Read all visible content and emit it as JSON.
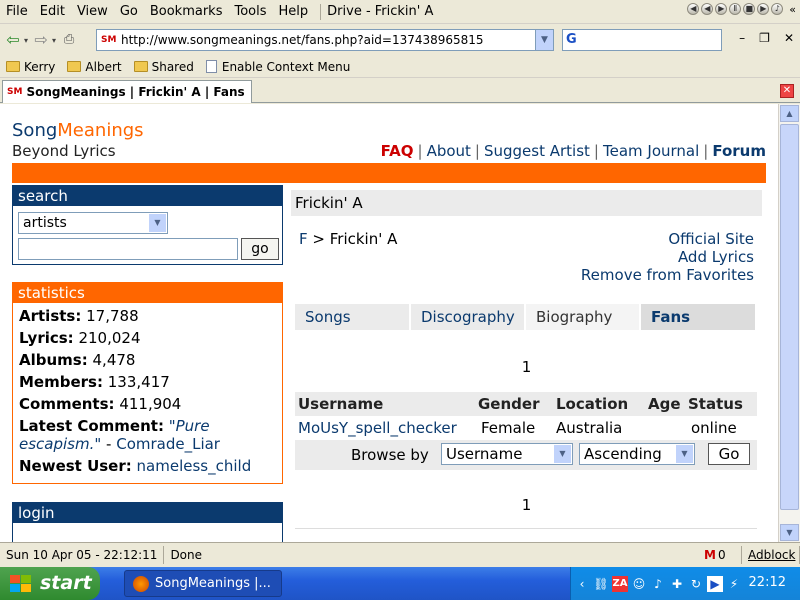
{
  "menu": {
    "items": [
      "File",
      "Edit",
      "View",
      "Go",
      "Bookmarks",
      "Tools",
      "Help"
    ],
    "window_title": "Drive - Frickin' A"
  },
  "nav": {
    "url": "http://www.songmeanings.net/fans.php?aid=137438965815",
    "search_engine_letter": "G"
  },
  "bookmarks": [
    {
      "label": "Kerry",
      "icon": "folder-icon"
    },
    {
      "label": "Albert",
      "icon": "folder-icon"
    },
    {
      "label": "Shared",
      "icon": "folder-icon"
    },
    {
      "label": "Enable Context Menu",
      "icon": "page-icon"
    }
  ],
  "tab": {
    "favicon": "SM",
    "title": "SongMeanings | Frickin' A | Fans"
  },
  "site": {
    "logo_song": "Song",
    "logo_meanings": "Meanings",
    "tagline": "Beyond Lyrics",
    "nav": [
      "FAQ",
      "About",
      "Suggest Artist",
      "Team Journal",
      "Forum"
    ],
    "separator": "|"
  },
  "search": {
    "header": "search",
    "selected": "artists",
    "go": "go"
  },
  "statistics": {
    "header": "statistics",
    "rows": [
      {
        "label": "Artists:",
        "value": "17,788"
      },
      {
        "label": "Lyrics:",
        "value": "210,024"
      },
      {
        "label": "Albums:",
        "value": "4,478"
      },
      {
        "label": "Members:",
        "value": "133,417"
      },
      {
        "label": "Comments:",
        "value": "411,904"
      }
    ],
    "latest_label": "Latest Comment:",
    "latest_quote": "\"Pure escapism.\"",
    "latest_dash": " - ",
    "latest_user": "Comrade_Liar",
    "newest_label": "Newest User:",
    "newest_user": "nameless_child"
  },
  "login": {
    "header": "login"
  },
  "main": {
    "title": "Frickin' A",
    "crumb_letter": "F",
    "crumb_sep": " > ",
    "crumb_artist": "Frickin' A",
    "links": [
      "Official Site",
      "Add Lyrics",
      "Remove from Favorites"
    ],
    "tabs": [
      "Songs",
      "Discography",
      "Biography",
      "Fans"
    ],
    "page_top": "1",
    "page_bottom": "1",
    "columns": [
      "Username",
      "Gender",
      "Location",
      "Age",
      "Status"
    ],
    "rows": [
      {
        "username": "MoUsY_spell_checker",
        "gender": "Female",
        "location": "Australia",
        "age": "",
        "status": "online"
      }
    ],
    "browse_label": "Browse by",
    "browse_sort": "Username",
    "browse_order": "Ascending",
    "browse_go": "Go"
  },
  "status": {
    "datetime": "Sun 10 Apr 05 - 22:12:11",
    "state": "Done",
    "mail_count": "0",
    "adblock": "Adblock"
  },
  "taskbar": {
    "start": "start",
    "item": "SongMeanings |...",
    "clock": "22:12"
  },
  "colors": {
    "brand_blue": "#0b3a6e",
    "brand_orange": "#ff6600",
    "faq_red": "#cc0000"
  }
}
